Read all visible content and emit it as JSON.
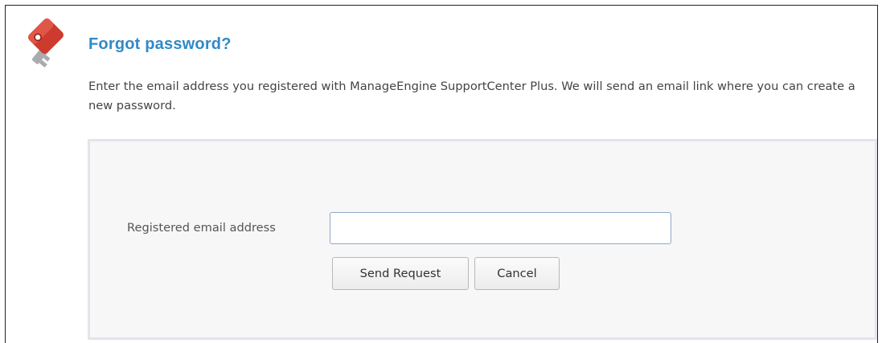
{
  "page": {
    "title": "Forgot password?",
    "description": "Enter the email address you registered with ManageEngine SupportCenter Plus. We will send an email link where you can create a new password.",
    "icon": "key-icon"
  },
  "form": {
    "email_label": "Registered email address",
    "email_value": "",
    "email_placeholder": "",
    "send_button_label": "Send Request",
    "cancel_button_label": "Cancel"
  },
  "colors": {
    "title": "#2f8ac7",
    "panel_background": "#f7f7f7",
    "panel_border": "#e3e5ec",
    "key_red": "#cc3b2e"
  }
}
